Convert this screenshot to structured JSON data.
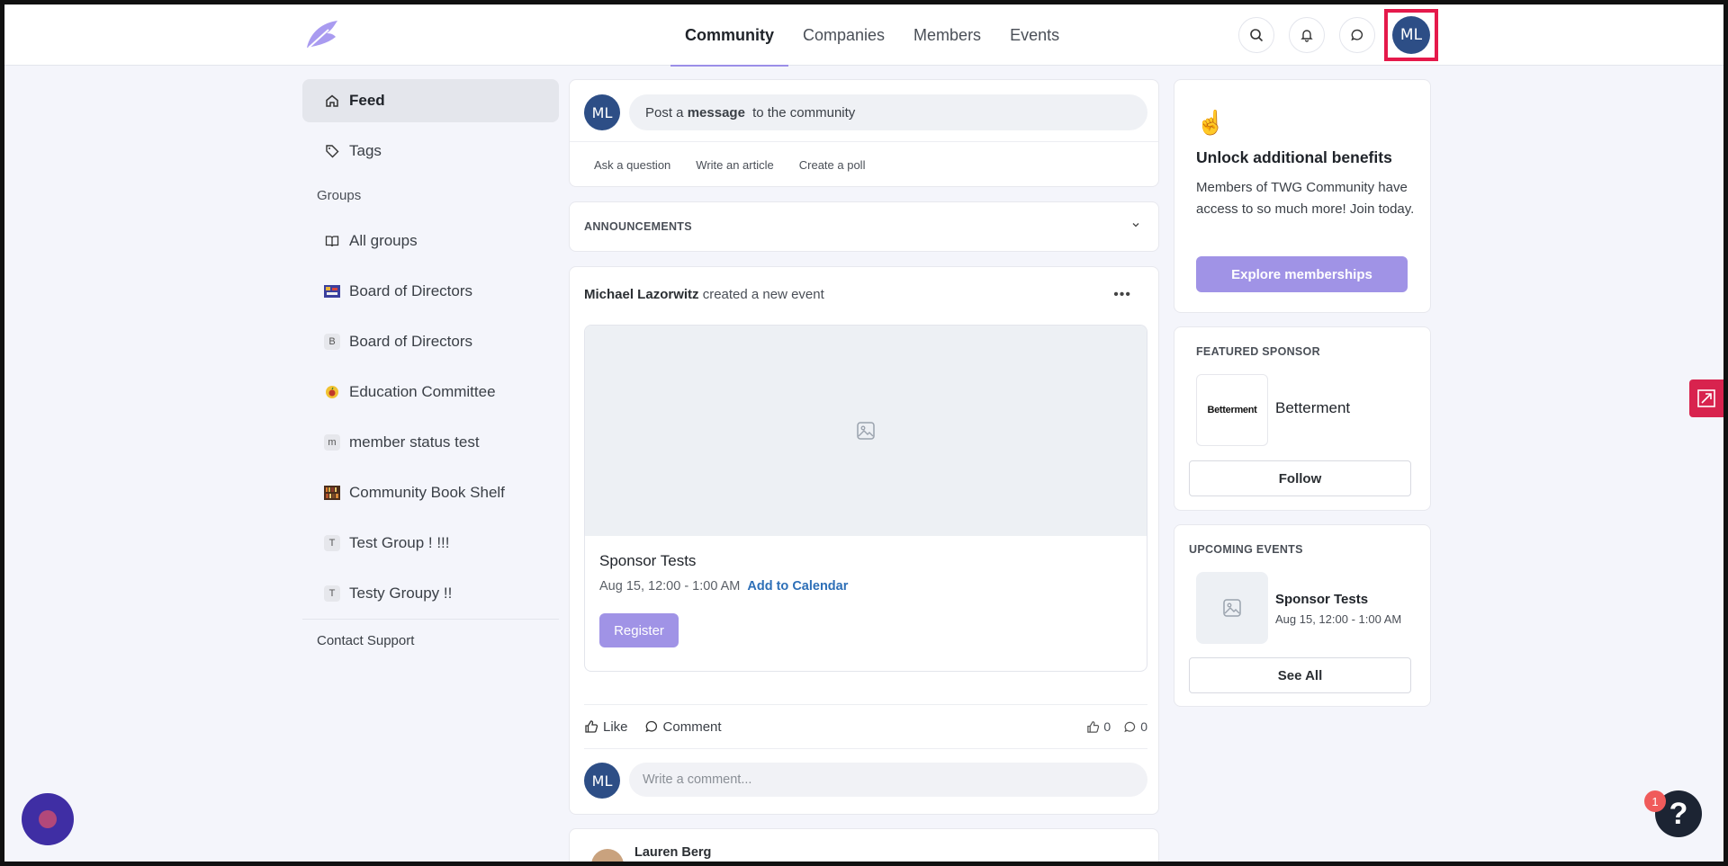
{
  "nav": {
    "links": [
      "Community",
      "Companies",
      "Members",
      "Events"
    ],
    "active": "Community",
    "user_initials": "ML"
  },
  "sidebar": {
    "items": [
      {
        "label": "Feed",
        "icon": "home-icon"
      },
      {
        "label": "Tags",
        "icon": "tag-icon"
      }
    ],
    "groups_label": "Groups",
    "groups": [
      {
        "label": "All groups",
        "icon": "book-open-icon"
      },
      {
        "label": "Board of Directors",
        "icon": "group-thumbnail"
      },
      {
        "label": "Board of Directors",
        "badge": "B"
      },
      {
        "label": "Education Committee",
        "icon": "apple-icon"
      },
      {
        "label": "member status test",
        "badge": "m"
      },
      {
        "label": "Community Book Shelf",
        "icon": "group-thumbnail"
      },
      {
        "label": "Test Group ! !!!",
        "badge": "T"
      },
      {
        "label": "Testy Groupy !!",
        "badge": "T"
      }
    ],
    "contact_support": "Contact Support"
  },
  "composer": {
    "initials": "ML",
    "prompt_pre": "Post a ",
    "prompt_bold": "message",
    "prompt_post": " to the community",
    "actions": [
      "Ask a question",
      "Write an article",
      "Create a poll"
    ]
  },
  "announcements": {
    "label": "ANNOUNCEMENTS"
  },
  "post": {
    "author": "Michael Lazorwitz",
    "action": " created a new event",
    "event_title": "Sponsor Tests",
    "event_date": "Aug 15, 12:00 - 1:00 AM",
    "add_to_calendar": "Add to Calendar",
    "register": "Register",
    "like": "Like",
    "comment": "Comment",
    "like_count": "0",
    "comment_count": "0",
    "comment_initials": "ML",
    "comment_placeholder": "Write a comment..."
  },
  "next_post": {
    "author": "Lauren Berg"
  },
  "benefits": {
    "emoji": "☝️",
    "title": "Unlock additional benefits",
    "text": "Members of TWG Community have access to so much more! Join today.",
    "button": "Explore memberships"
  },
  "sponsor": {
    "label": "FEATURED SPONSOR",
    "logo_text": "Betterment",
    "name": "Betterment",
    "follow": "Follow"
  },
  "upcoming": {
    "label": "UPCOMING EVENTS",
    "event_name": "Sponsor Tests",
    "event_time": "Aug 15, 12:00 - 1:00 AM",
    "see_all": "See All"
  },
  "help": {
    "badge": "1",
    "symbol": "?"
  },
  "colors": {
    "accent": "#a093e6",
    "avatar": "#2d4e86",
    "highlight": "#e5194b"
  }
}
